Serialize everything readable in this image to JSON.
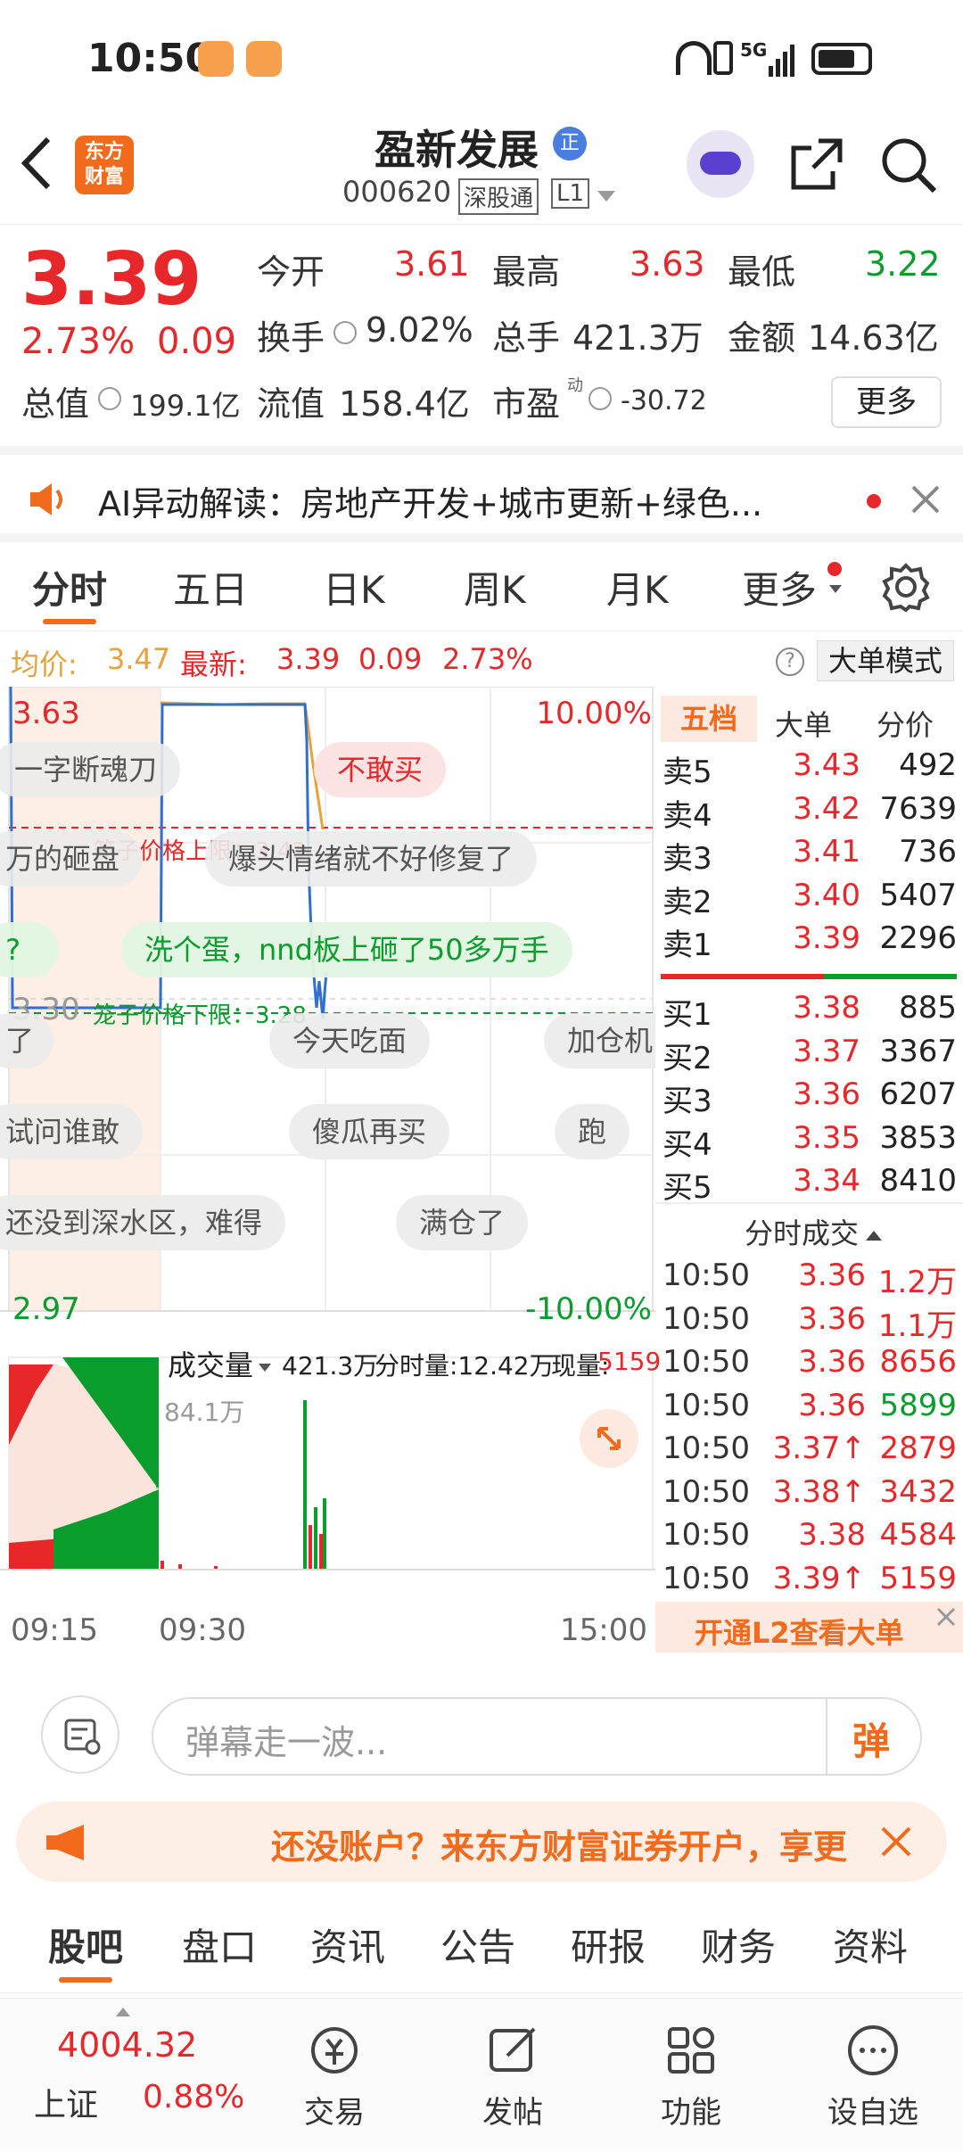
{
  "status_bar": {
    "time": "10:50",
    "network": "5G"
  },
  "header": {
    "back": "<",
    "logo_line1": "东方",
    "logo_line2": "财富",
    "stock_name": "盈新发展",
    "badge": "正",
    "code": "000620",
    "exchange_tag": "深股通",
    "level_tag": "L1"
  },
  "quote": {
    "price": "3.39",
    "change_pct": "2.73%",
    "change_amt": "0.09",
    "open_label": "今开",
    "open": "3.61",
    "high_label": "最高",
    "high": "3.63",
    "low_label": "最低",
    "low": "3.22",
    "turnover_label": "换手",
    "turnover": "9.02%",
    "volume_label": "总手",
    "volume": "421.3万",
    "amount_label": "金额",
    "amount": "14.63亿",
    "mktcap_label": "总值",
    "mktcap": "199.1亿",
    "float_label": "流值",
    "float": "158.4亿",
    "pe_label": "市盈",
    "pe_sup": "动",
    "pe": "-30.72",
    "more_button": "更多"
  },
  "ai": {
    "text": "AI异动解读：房地产开发+城市更新+绿色..."
  },
  "tabs": [
    "分时",
    "五日",
    "日K",
    "周K",
    "月K",
    "更多"
  ],
  "chart_header": {
    "avg_label": "均价:",
    "avg": "3.47",
    "latest_label": "最新:",
    "latest": "3.39",
    "chg": "0.09",
    "pct": "2.73%",
    "mode_button": "大单模式"
  },
  "chart_labels": {
    "top_price": "3.63",
    "top_pct": "10.00%",
    "mid_price": "3.30",
    "bottom_price": "2.97",
    "bottom_pct": "-10.00%",
    "upper_limit": "笼子价格上限：3.42",
    "lower_limit": "笼子价格下限：3.28"
  },
  "danmaku": [
    "一字断魂刀",
    "不敢买",
    "万的砸盘",
    "爆头情绪就不好修复了",
    "?",
    "洗个蛋，nnd板上砸了50多万手",
    "了",
    "今天吃面",
    "加仓机",
    "试问谁敢",
    "傻瓜再买",
    "跑",
    "还没到深水区，难得",
    "满仓了"
  ],
  "volume_header": {
    "label": "成交量",
    "total": "421.3万",
    "min_label": "分时量:12.42万",
    "now_label": "现量:",
    "now": "5159",
    "max": "84.1万"
  },
  "time_axis": [
    "09:15",
    "09:30",
    "15:00"
  ],
  "book_tabs": [
    "五档",
    "大单",
    "分价"
  ],
  "asks": [
    {
      "label": "卖5",
      "price": "3.43",
      "vol": "492"
    },
    {
      "label": "卖4",
      "price": "3.42",
      "vol": "7639"
    },
    {
      "label": "卖3",
      "price": "3.41",
      "vol": "736"
    },
    {
      "label": "卖2",
      "price": "3.40",
      "vol": "5407"
    },
    {
      "label": "卖1",
      "price": "3.39",
      "vol": "2296"
    }
  ],
  "bids": [
    {
      "label": "买1",
      "price": "3.38",
      "vol": "885"
    },
    {
      "label": "买2",
      "price": "3.37",
      "vol": "3367"
    },
    {
      "label": "买3",
      "price": "3.36",
      "vol": "6207"
    },
    {
      "label": "买4",
      "price": "3.35",
      "vol": "3853"
    },
    {
      "label": "买5",
      "price": "3.34",
      "vol": "8410"
    }
  ],
  "ticks_title": "分时成交",
  "ticks": [
    {
      "t": "10:50",
      "p": "3.36",
      "v": "1.2万",
      "c": "red"
    },
    {
      "t": "10:50",
      "p": "3.36",
      "v": "1.1万",
      "c": "red"
    },
    {
      "t": "10:50",
      "p": "3.36",
      "v": "8656",
      "c": "red"
    },
    {
      "t": "10:50",
      "p": "3.36",
      "v": "5899",
      "c": "green"
    },
    {
      "t": "10:50",
      "p": "3.37↑",
      "v": "2879",
      "c": "red"
    },
    {
      "t": "10:50",
      "p": "3.38↑",
      "v": "3432",
      "c": "red"
    },
    {
      "t": "10:50",
      "p": "3.38",
      "v": "4584",
      "c": "red"
    },
    {
      "t": "10:50",
      "p": "3.39↑",
      "v": "5159",
      "c": "red"
    }
  ],
  "l2_banner": "开通L2查看大单",
  "comment": {
    "placeholder": "弹幕走一波...",
    "send": "弹"
  },
  "promo": {
    "text": "还没账户？来东方财富证券开户，享更"
  },
  "section_tabs": [
    "股吧",
    "盘口",
    "资讯",
    "公告",
    "研报",
    "财务",
    "资料"
  ],
  "bottom": {
    "index_value": "4004.32",
    "index_name": "上证",
    "index_pct": "0.88%",
    "items": [
      "交易",
      "发帖",
      "功能",
      "设自选"
    ]
  },
  "colors": {
    "up": "#e8272a",
    "down": "#0a9c2c",
    "accent": "#f26a1b"
  }
}
